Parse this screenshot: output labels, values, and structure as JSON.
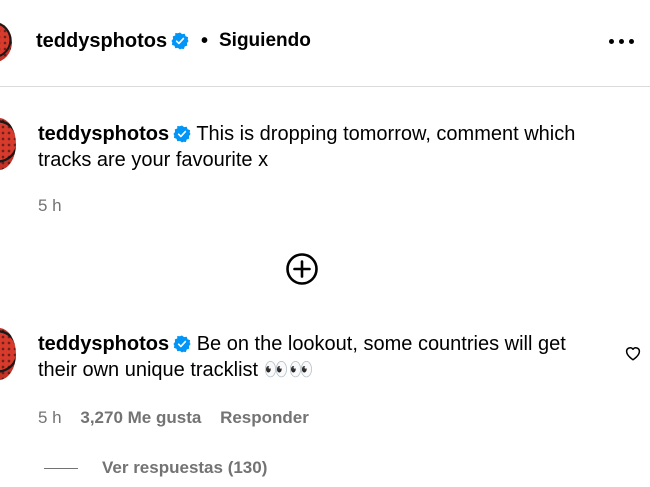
{
  "header": {
    "username": "teddysphotos",
    "separator": "•",
    "follow_status": "Siguiendo",
    "more_icon": "more-horizontal-icon"
  },
  "caption": {
    "username": "teddysphotos",
    "text": "This is dropping tomorrow, comment which tracks are your favourite x",
    "time": "5 h"
  },
  "load_more_icon": "plus-circle-icon",
  "comment": {
    "username": "teddysphotos",
    "text": "Be on the lookout, some countries will get their own unique tracklist 👀👀",
    "time": "5 h",
    "likes": "3,270 Me gusta",
    "reply_label": "Responder",
    "view_replies": "Ver respuestas (130)",
    "like_icon": "heart-icon"
  },
  "colors": {
    "verified": "#0095f6",
    "muted": "#737373",
    "divider": "#dbdbdb"
  }
}
